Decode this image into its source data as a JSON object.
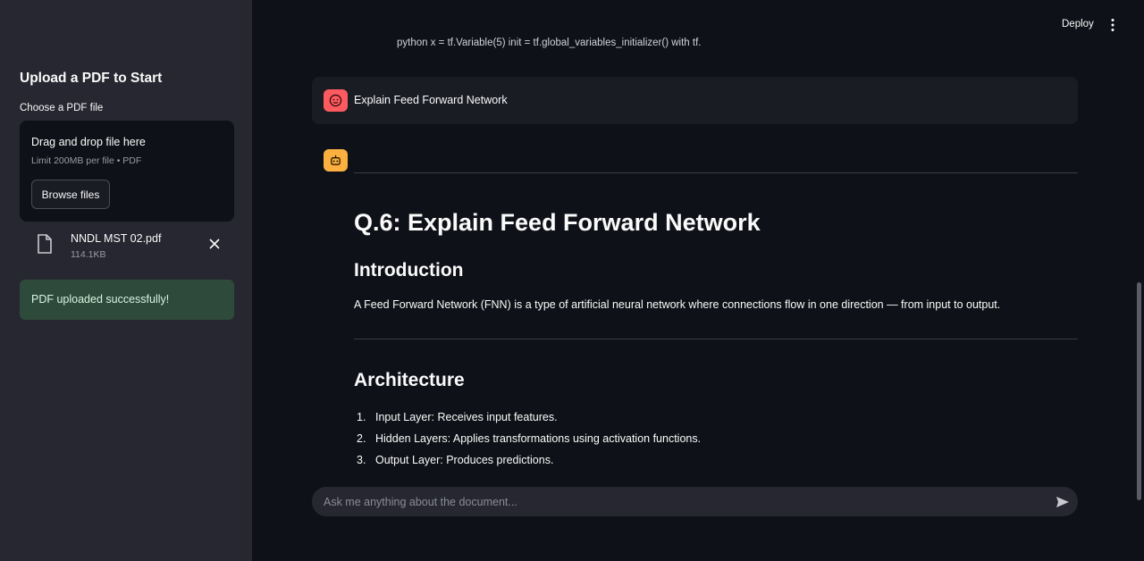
{
  "sidebar": {
    "title": "Upload a PDF to Start",
    "uploader_label": "Choose a PDF file",
    "dropzone_title": "Drag and drop file here",
    "dropzone_limit": "Limit 200MB per file • PDF",
    "browse_label": "Browse files",
    "file": {
      "name": "NNDL MST 02.pdf",
      "size": "114.1KB",
      "icon": "file-icon",
      "remove_icon": "close-icon"
    },
    "success_message": "PDF uploaded successfully!"
  },
  "header": {
    "deploy_label": "Deploy",
    "menu_icon": "kebab-menu-icon"
  },
  "chat": {
    "partial_text": "python x = tf.Variable(5) init = tf.global_variables_initializer() with tf.",
    "user_message": "Explain Feed Forward Network",
    "user_avatar_icon": "user-face-icon",
    "bot_avatar_icon": "robot-icon",
    "answer": {
      "heading": "Q.6: Explain Feed Forward Network",
      "intro_heading": "Introduction",
      "intro_text": "A Feed Forward Network (FNN) is a type of artificial neural network where connections flow in one direction — from input to output.",
      "arch_heading": "Architecture",
      "arch_items": [
        {
          "num": "1.",
          "text": "Input Layer: Receives input features."
        },
        {
          "num": "2.",
          "text": "Hidden Layers: Applies transformations using activation functions."
        },
        {
          "num": "3.",
          "text": "Output Layer: Produces predictions."
        }
      ]
    },
    "input_placeholder": "Ask me anything about the document...",
    "send_icon": "send-icon"
  },
  "colors": {
    "sidebar_bg": "#262730",
    "main_bg": "#0e1117",
    "user_avatar": "#ff5a5f",
    "bot_avatar": "#fbb040",
    "success_bg": "#2e4a3a"
  }
}
